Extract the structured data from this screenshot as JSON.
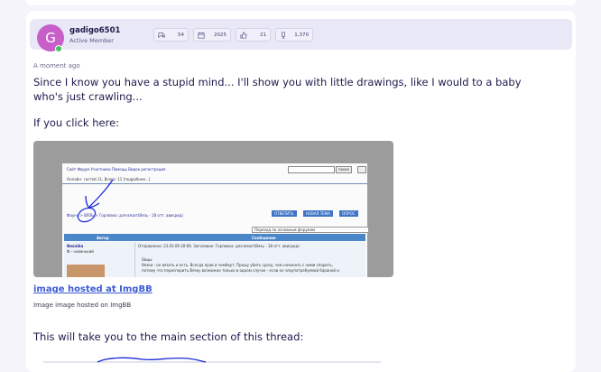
{
  "user": {
    "name": "gadigo6501",
    "role": "Active Member",
    "avatar_letter": "G",
    "avatar_color": "#c85fc8"
  },
  "stats": [
    {
      "icon": "messages-icon",
      "value": "54"
    },
    {
      "icon": "calendar-icon",
      "value": "2025"
    },
    {
      "icon": "thumbs-up-icon",
      "value": "21"
    },
    {
      "icon": "trophy-icon",
      "value": "1,370"
    }
  ],
  "post": {
    "timestamp": "A moment ago",
    "paragraph1": "Since I know you have a stupid mind... I'll show you with little drawings, like I would to a baby who's just crawling...",
    "paragraph2": "If you click here:",
    "image_link": "image hosted at ImgBB",
    "image_caption": "Image image hosted on ImgBB",
    "paragraph3": "This will take you to the main section of this thread:"
  },
  "screenshot": {
    "nav_links": "Сайт  Форум  Участники  Помощь  Видео регистрация",
    "online": "Онлайн: гостей 11, Всего: 11  [подробнее...]",
    "search_button": "поиск",
    "breadcrumb": "Фоуня > ВЯЗЬ > Горловка: для вязат(Вязь - 18 отт. ависред)",
    "btn1": "ОТВЕТИТЬ",
    "btn2": "НОВАЯ ТЕМА",
    "btn3": "ОПРОС",
    "select": "Переход по основным форумам",
    "col_author": "Автор",
    "col_message": "Сообщение",
    "author_name": "Nesniba",
    "author_status": "Ф - новенький",
    "msg_header": "Отправлено: 23.03.09 20:06. Заголовок: Горловка: для вязат(Вязь - 18 отт. ависред)",
    "msg_line1": "Овцы",
    "msg_line2": "Вязки - он вязать и есть. Всегда прав и чемберт. Прошу убить сразу, чем начинать с ними спорить,",
    "msg_line3": "потому что переспорить Вязку возможно только в одном случае - если он злоупотребуемой бараной и"
  }
}
